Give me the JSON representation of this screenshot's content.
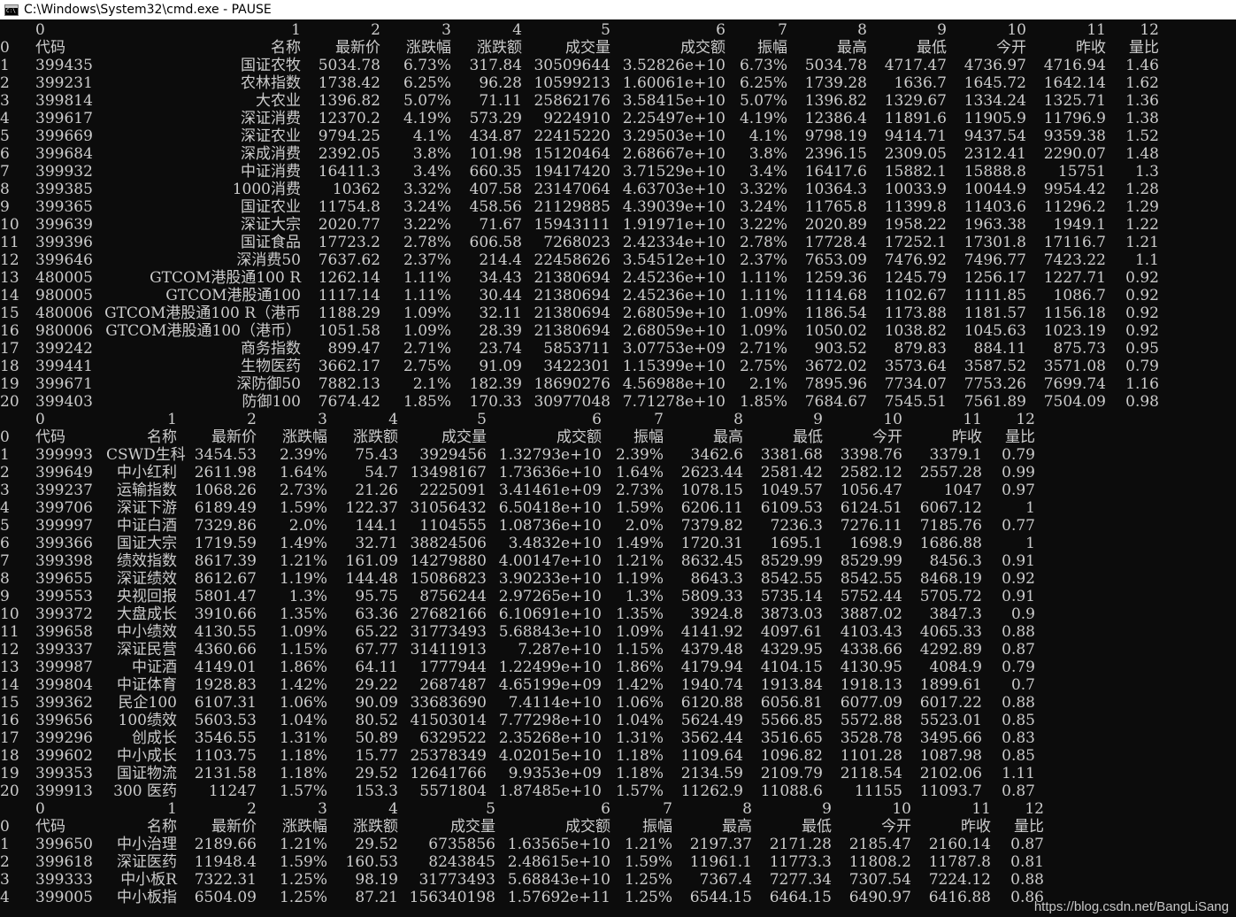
{
  "window": {
    "title": "C:\\Windows\\System32\\cmd.exe - PAUSE",
    "icon": "cmd-icon",
    "background": "#0c0c0c",
    "foreground": "#cccccc"
  },
  "blocks": [
    {
      "indices": [
        "0",
        "1",
        "2",
        "3",
        "4",
        "5",
        "6",
        "7",
        "8",
        "9",
        "10",
        "11",
        "12"
      ],
      "header": [
        "0",
        "代码",
        "名称",
        "最新价",
        "涨跌幅",
        "涨跌额",
        "成交量",
        "成交额",
        "振幅",
        "最高",
        "最低",
        "今开",
        "昨收",
        "量比"
      ],
      "rows": [
        [
          "1",
          "399435",
          "国证农牧",
          "5034.78",
          "6.73%",
          "317.84",
          "30509644",
          "3.52826e+10",
          "6.73%",
          "5034.78",
          "4717.47",
          "4736.97",
          "4716.94",
          "1.46"
        ],
        [
          "2",
          "399231",
          "农林指数",
          "1738.42",
          "6.25%",
          "96.28",
          "10599213",
          "1.60061e+10",
          "6.25%",
          "1739.28",
          "1636.7",
          "1645.72",
          "1642.14",
          "1.62"
        ],
        [
          "3",
          "399814",
          "大农业",
          "1396.82",
          "5.07%",
          "71.11",
          "25862176",
          "3.58415e+10",
          "5.07%",
          "1396.82",
          "1329.67",
          "1334.24",
          "1325.71",
          "1.36"
        ],
        [
          "4",
          "399617",
          "深证消费",
          "12370.2",
          "4.19%",
          "573.29",
          "9224910",
          "2.25497e+10",
          "4.19%",
          "12386.4",
          "11891.6",
          "11905.9",
          "11796.9",
          "1.38"
        ],
        [
          "5",
          "399669",
          "深证农业",
          "9794.25",
          "4.1%",
          "434.87",
          "22415220",
          "3.29503e+10",
          "4.1%",
          "9798.19",
          "9414.71",
          "9437.54",
          "9359.38",
          "1.52"
        ],
        [
          "6",
          "399684",
          "深成消费",
          "2392.05",
          "3.8%",
          "101.98",
          "15120464",
          "2.68667e+10",
          "3.8%",
          "2396.15",
          "2309.05",
          "2312.41",
          "2290.07",
          "1.48"
        ],
        [
          "7",
          "399932",
          "中证消费",
          "16411.3",
          "3.4%",
          "660.35",
          "19417420",
          "3.71529e+10",
          "3.4%",
          "16417.6",
          "15882.1",
          "15888.8",
          "15751",
          "1.3"
        ],
        [
          "8",
          "399385",
          "1000消费",
          "10362",
          "3.32%",
          "407.58",
          "23147064",
          "4.63703e+10",
          "3.32%",
          "10364.3",
          "10033.9",
          "10044.9",
          "9954.42",
          "1.28"
        ],
        [
          "9",
          "399365",
          "国证农业",
          "11754.8",
          "3.24%",
          "458.56",
          "21129885",
          "4.39039e+10",
          "3.24%",
          "11765.8",
          "11399.8",
          "11403.6",
          "11296.2",
          "1.29"
        ],
        [
          "10",
          "399639",
          "深证大宗",
          "2020.77",
          "3.22%",
          "71.67",
          "15943111",
          "1.91971e+10",
          "3.22%",
          "2020.89",
          "1958.22",
          "1963.38",
          "1949.1",
          "1.22"
        ],
        [
          "11",
          "399396",
          "国证食品",
          "17723.2",
          "2.78%",
          "606.58",
          "7268023",
          "2.42334e+10",
          "2.78%",
          "17728.4",
          "17252.1",
          "17301.8",
          "17116.7",
          "1.21"
        ],
        [
          "12",
          "399646",
          "深消费50",
          "7637.62",
          "2.37%",
          "214.4",
          "22458626",
          "3.54512e+10",
          "2.37%",
          "7653.09",
          "7476.92",
          "7496.77",
          "7423.22",
          "1.1"
        ],
        [
          "13",
          "480005",
          "GTCOM港股通100 R",
          "1262.14",
          "1.11%",
          "34.43",
          "21380694",
          "2.45236e+10",
          "1.11%",
          "1259.36",
          "1245.79",
          "1256.17",
          "1227.71",
          "0.92"
        ],
        [
          "14",
          "980005",
          "GTCOM港股通100",
          "1117.14",
          "1.11%",
          "30.44",
          "21380694",
          "2.45236e+10",
          "1.11%",
          "1114.68",
          "1102.67",
          "1111.85",
          "1086.7",
          "0.92"
        ],
        [
          "15",
          "480006",
          "GTCOM港股通100 R（港币",
          "1188.29",
          "1.09%",
          "32.11",
          "21380694",
          "2.68059e+10",
          "1.09%",
          "1186.54",
          "1173.88",
          "1181.57",
          "1156.18",
          "0.92"
        ],
        [
          "16",
          "980006",
          "GTCOM港股通100（港币）",
          "1051.58",
          "1.09%",
          "28.39",
          "21380694",
          "2.68059e+10",
          "1.09%",
          "1050.02",
          "1038.82",
          "1045.63",
          "1023.19",
          "0.92"
        ],
        [
          "17",
          "399242",
          "商务指数",
          "899.47",
          "2.71%",
          "23.74",
          "5853711",
          "3.07753e+09",
          "2.71%",
          "903.52",
          "879.83",
          "884.11",
          "875.73",
          "0.95"
        ],
        [
          "18",
          "399441",
          "生物医药",
          "3662.17",
          "2.75%",
          "91.09",
          "3422301",
          "1.15399e+10",
          "2.75%",
          "3672.02",
          "3573.64",
          "3587.52",
          "3571.08",
          "0.79"
        ],
        [
          "19",
          "399671",
          "深防御50",
          "7882.13",
          "2.1%",
          "182.39",
          "18690276",
          "4.56988e+10",
          "2.1%",
          "7895.96",
          "7734.07",
          "7753.26",
          "7699.74",
          "1.16"
        ],
        [
          "20",
          "399403",
          "防御100",
          "7674.42",
          "1.85%",
          "170.33",
          "30977048",
          "7.71278e+10",
          "1.85%",
          "7684.67",
          "7545.51",
          "7561.89",
          "7504.09",
          "0.98"
        ]
      ]
    },
    {
      "indices": [
        "0",
        "1",
        "2",
        "3",
        "4",
        "5",
        "6",
        "7",
        "8",
        "9",
        "10",
        "11",
        "12"
      ],
      "header": [
        "0",
        "代码",
        "名称",
        "最新价",
        "涨跌幅",
        "涨跌额",
        "成交量",
        "成交额",
        "振幅",
        "最高",
        "最低",
        "今开",
        "昨收",
        "量比"
      ],
      "rows": [
        [
          "1",
          "399993",
          "CSWD生科",
          "3454.53",
          "2.39%",
          "75.43",
          "3929456",
          "1.32793e+10",
          "2.39%",
          "3462.6",
          "3381.68",
          "3398.76",
          "3379.1",
          "0.79"
        ],
        [
          "2",
          "399649",
          "中小红利",
          "2611.98",
          "1.64%",
          "54.7",
          "13498167",
          "1.73636e+10",
          "1.64%",
          "2623.44",
          "2581.42",
          "2582.12",
          "2557.28",
          "0.99"
        ],
        [
          "3",
          "399237",
          "运输指数",
          "1068.26",
          "2.73%",
          "21.26",
          "2225091",
          "3.41461e+09",
          "2.73%",
          "1078.15",
          "1049.57",
          "1056.47",
          "1047",
          "0.97"
        ],
        [
          "4",
          "399706",
          "深证下游",
          "6189.49",
          "1.59%",
          "122.37",
          "31056432",
          "6.50418e+10",
          "1.59%",
          "6206.11",
          "6109.53",
          "6124.51",
          "6067.12",
          "1"
        ],
        [
          "5",
          "399997",
          "中证白酒",
          "7329.86",
          "2.0%",
          "144.1",
          "1104555",
          "1.08736e+10",
          "2.0%",
          "7379.82",
          "7236.3",
          "7276.11",
          "7185.76",
          "0.77"
        ],
        [
          "6",
          "399366",
          "国证大宗",
          "1719.59",
          "1.49%",
          "32.71",
          "38824506",
          "3.4832e+10",
          "1.49%",
          "1720.31",
          "1695.1",
          "1698.9",
          "1686.88",
          "1"
        ],
        [
          "7",
          "399398",
          "绩效指数",
          "8617.39",
          "1.21%",
          "161.09",
          "14279880",
          "4.00147e+10",
          "1.21%",
          "8632.45",
          "8529.99",
          "8529.99",
          "8456.3",
          "0.91"
        ],
        [
          "8",
          "399655",
          "深证绩效",
          "8612.67",
          "1.19%",
          "144.48",
          "15086823",
          "3.90233e+10",
          "1.19%",
          "8643.3",
          "8542.55",
          "8542.55",
          "8468.19",
          "0.92"
        ],
        [
          "9",
          "399553",
          "央视回报",
          "5801.47",
          "1.3%",
          "95.75",
          "8756244",
          "2.97265e+10",
          "1.3%",
          "5809.33",
          "5735.14",
          "5752.44",
          "5705.72",
          "0.91"
        ],
        [
          "10",
          "399372",
          "大盘成长",
          "3910.66",
          "1.35%",
          "63.36",
          "27682166",
          "6.10691e+10",
          "1.35%",
          "3924.8",
          "3873.03",
          "3887.02",
          "3847.3",
          "0.9"
        ],
        [
          "11",
          "399658",
          "中小绩效",
          "4130.55",
          "1.09%",
          "65.22",
          "31773493",
          "5.68843e+10",
          "1.09%",
          "4141.92",
          "4097.61",
          "4103.43",
          "4065.33",
          "0.88"
        ],
        [
          "12",
          "399337",
          "深证民营",
          "4360.66",
          "1.15%",
          "67.77",
          "31411913",
          "7.287e+10",
          "1.15%",
          "4379.48",
          "4329.95",
          "4338.66",
          "4292.89",
          "0.87"
        ],
        [
          "13",
          "399987",
          "中证酒",
          "4149.01",
          "1.86%",
          "64.11",
          "1777944",
          "1.22499e+10",
          "1.86%",
          "4179.94",
          "4104.15",
          "4130.95",
          "4084.9",
          "0.79"
        ],
        [
          "14",
          "399804",
          "中证体育",
          "1928.83",
          "1.42%",
          "29.22",
          "2687487",
          "4.65199e+09",
          "1.42%",
          "1940.74",
          "1913.84",
          "1918.13",
          "1899.61",
          "0.7"
        ],
        [
          "15",
          "399362",
          "民企100",
          "6107.31",
          "1.06%",
          "90.09",
          "33683690",
          "7.4114e+10",
          "1.06%",
          "6120.88",
          "6056.81",
          "6077.09",
          "6017.22",
          "0.88"
        ],
        [
          "16",
          "399656",
          "100绩效",
          "5603.53",
          "1.04%",
          "80.52",
          "41503014",
          "7.77298e+10",
          "1.04%",
          "5624.49",
          "5566.85",
          "5572.88",
          "5523.01",
          "0.85"
        ],
        [
          "17",
          "399296",
          "创成长",
          "3546.55",
          "1.31%",
          "50.89",
          "6329522",
          "2.35268e+10",
          "1.31%",
          "3562.44",
          "3516.65",
          "3528.78",
          "3495.66",
          "0.83"
        ],
        [
          "18",
          "399602",
          "中小成长",
          "1103.75",
          "1.18%",
          "15.77",
          "25378349",
          "4.02015e+10",
          "1.18%",
          "1109.64",
          "1096.82",
          "1101.28",
          "1087.98",
          "0.85"
        ],
        [
          "19",
          "399353",
          "国证物流",
          "2131.58",
          "1.18%",
          "29.52",
          "12641766",
          "9.9353e+09",
          "1.18%",
          "2134.59",
          "2109.79",
          "2118.54",
          "2102.06",
          "1.11"
        ],
        [
          "20",
          "399913",
          "300 医药",
          "11247",
          "1.57%",
          "153.3",
          "5571804",
          "1.87485e+10",
          "1.57%",
          "11262.9",
          "11088.6",
          "11155",
          "11093.7",
          "0.87"
        ]
      ]
    },
    {
      "indices": [
        "0",
        "1",
        "2",
        "3",
        "4",
        "5",
        "6",
        "7",
        "8",
        "9",
        "10",
        "11",
        "12"
      ],
      "header": [
        "0",
        "代码",
        "名称",
        "最新价",
        "涨跌幅",
        "涨跌额",
        "成交量",
        "成交额",
        "振幅",
        "最高",
        "最低",
        "今开",
        "昨收",
        "量比"
      ],
      "rows": [
        [
          "1",
          "399650",
          "中小治理",
          "2189.66",
          "1.21%",
          "29.52",
          "6735856",
          "1.63565e+10",
          "1.21%",
          "2197.37",
          "2171.28",
          "2185.47",
          "2160.14",
          "0.87"
        ],
        [
          "2",
          "399618",
          "深证医药",
          "11948.4",
          "1.59%",
          "160.53",
          "8243845",
          "2.48615e+10",
          "1.59%",
          "11961.1",
          "11773.3",
          "11808.2",
          "11787.8",
          "0.81"
        ],
        [
          "3",
          "399333",
          "中小板R",
          "7322.31",
          "1.25%",
          "98.19",
          "31773493",
          "5.68843e+10",
          "1.25%",
          "7367.4",
          "7277.34",
          "7307.54",
          "7224.12",
          "0.88"
        ],
        [
          "4",
          "399005",
          "中小板指",
          "6504.09",
          "1.25%",
          "87.21",
          "156340198",
          "1.57692e+11",
          "1.25%",
          "6544.15",
          "6464.15",
          "6490.97",
          "6416.88",
          "0.86"
        ]
      ]
    }
  ],
  "watermark": "https://blog.csdn.net/BangLiSang"
}
